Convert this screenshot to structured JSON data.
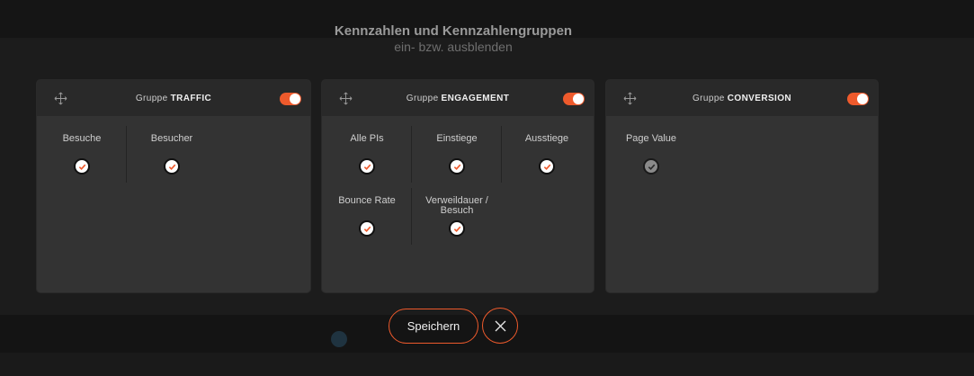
{
  "header": {
    "title": "Kennzahlen und Kennzahlengruppen",
    "subtitle": "ein- bzw. ausblenden"
  },
  "groups": [
    {
      "prefix": "Gruppe",
      "name": "TRAFFIC",
      "enabled": true,
      "metrics": [
        {
          "label": "Besuche",
          "checked": true
        },
        {
          "label": "Besucher",
          "checked": true
        }
      ]
    },
    {
      "prefix": "Gruppe",
      "name": "ENGAGEMENT",
      "enabled": true,
      "metrics": [
        {
          "label": "Alle PIs",
          "checked": true
        },
        {
          "label": "Einstiege",
          "checked": true
        },
        {
          "label": "Ausstiege",
          "checked": true
        },
        {
          "label": "Bounce Rate",
          "checked": true
        },
        {
          "label": "Verweildauer / Besuch",
          "checked": true
        }
      ]
    },
    {
      "prefix": "Gruppe",
      "name": "CONVERSION",
      "enabled": true,
      "metrics": [
        {
          "label": "Page Value",
          "checked": true,
          "muted": true
        }
      ]
    }
  ],
  "actions": {
    "save_label": "Speichern",
    "close_icon": "close-icon"
  },
  "colors": {
    "accent": "#ee5a2c",
    "check": "#ee5a2c",
    "panel": "#333333",
    "panel_header": "#292929"
  }
}
